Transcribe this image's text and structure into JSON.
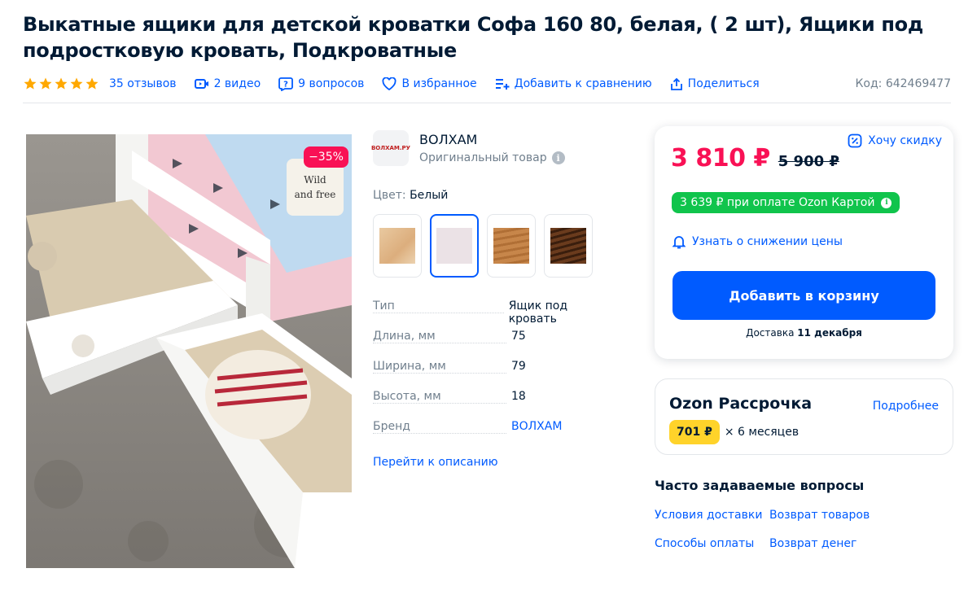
{
  "product": {
    "title": "Выкатные ящики для детской кроватки Софа 160 80, белая, ( 2 шт), Ящики под подростковую кровать, Подкроватные",
    "rating": 5,
    "reviews": "35 отзывов",
    "videos": "2 видео",
    "questions": "9 вопросов",
    "favorite": "В избранное",
    "compare": "Добавить к сравнению",
    "share": "Поделиться",
    "code": "Код: 642469477",
    "discount_badge": "−35%"
  },
  "brand": {
    "name": "ВОЛХАМ",
    "logo_text": "ВОЛХАМ.РУ",
    "original": "Оригинальный товар"
  },
  "color": {
    "label": "Цвет:",
    "value": "Белый",
    "swatches": [
      {
        "name": "light-pine",
        "color": "#e7c49c",
        "selected": false
      },
      {
        "name": "white",
        "color": "#ebe2e6",
        "selected": true
      },
      {
        "name": "oak",
        "color": "#c7864a",
        "selected": false
      },
      {
        "name": "dark-wood",
        "color": "#6a3b1d",
        "selected": false
      }
    ]
  },
  "specs": [
    {
      "name": "Тип",
      "value": "Ящик под кровать"
    },
    {
      "name": "Длина, мм",
      "value": "75"
    },
    {
      "name": "Ширина, мм",
      "value": "79"
    },
    {
      "name": "Высота, мм",
      "value": "18"
    },
    {
      "name": "Бренд",
      "value": "ВОЛХАМ"
    }
  ],
  "to_description": "Перейти к описанию",
  "buy": {
    "want_discount": "Хочу скидку",
    "price": "3 810 ₽",
    "old_price": "5 900 ₽",
    "card_price": "3 639 ₽ при оплате Ozon Картой",
    "notify": "Узнать о снижении цены",
    "cart_button": "Добавить в корзину",
    "delivery_prefix": "Доставка",
    "delivery_date": "11 декабря"
  },
  "installment": {
    "title": "Ozon Рассрочка",
    "more": "Подробнее",
    "amount": "701 ₽",
    "term": "× 6 месяцев"
  },
  "faq": {
    "title": "Часто задаваемые вопросы",
    "links": [
      "Условия доставки",
      "Возврат товаров",
      "Способы оплаты",
      "Возврат денег"
    ]
  },
  "colors": {
    "accent": "#005bff",
    "price": "#f91155",
    "card": "#10c44c",
    "star": "#ffa800",
    "installment": "#ffd32a"
  }
}
